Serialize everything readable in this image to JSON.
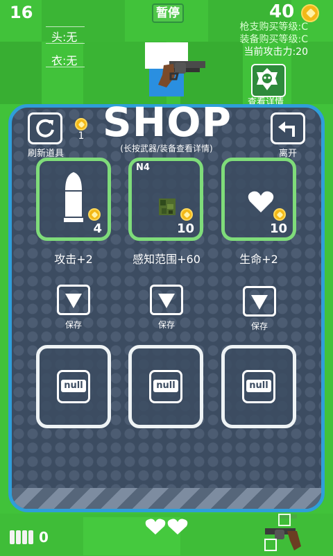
{
  "hud": {
    "score": "16",
    "pause_label": "暂停",
    "coins": "40",
    "head_label": "头:无",
    "body_label": "衣:无",
    "gun_level": "枪支购买等级:C",
    "equip_level": "装备购买等级:C",
    "attack_power": "当前攻击力:20",
    "detail_label": "查看详情",
    "ammo_count": "0"
  },
  "shop": {
    "title": "SHOP",
    "subtitle": "(长按武器/装备查看详情)",
    "refresh_label": "刷新道具",
    "refresh_cost": "1",
    "leave_label": "离开",
    "items": [
      {
        "name": "攻击+2",
        "price": "4",
        "icon": "bullet-icon"
      },
      {
        "name": "感知范围+60",
        "price": "10",
        "icon": "camouflage-chip-icon",
        "tag": "N4"
      },
      {
        "name": "生命+2",
        "price": "10",
        "icon": "heart-icon"
      }
    ],
    "save_label": "保存",
    "storage": [
      {
        "label": "null"
      },
      {
        "label": "null"
      },
      {
        "label": "null"
      }
    ]
  },
  "colors": {
    "grass": "#3fbf3a",
    "panel": "#3c4c61",
    "panel_border": "#2f9ed9",
    "item_border": "#7fdc7a",
    "coin": "#f3b817"
  }
}
